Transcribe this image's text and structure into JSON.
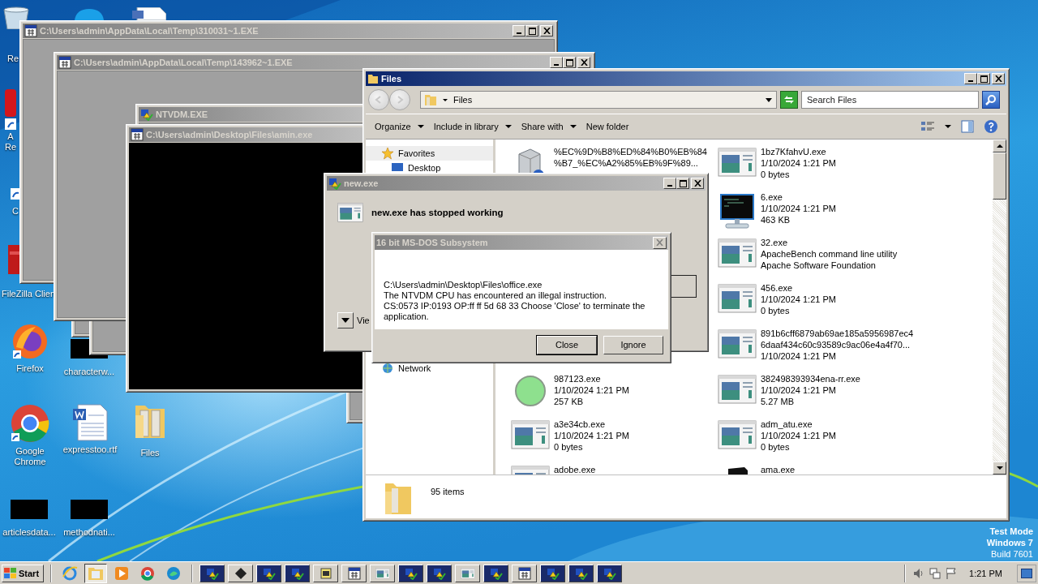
{
  "desktop_icons": [
    {
      "label": "Re",
      "kind": "recycle-bin"
    },
    {
      "label": "A Re",
      "kind": "acrobat"
    },
    {
      "label": "C",
      "kind": "shortcut"
    },
    {
      "label": "FileZilla Clien",
      "kind": "filezilla"
    },
    {
      "label": "Firefox",
      "kind": "firefox"
    },
    {
      "label": "characterw...",
      "kind": "black-thumbnail"
    },
    {
      "label": "Google Chrome",
      "kind": "chrome"
    },
    {
      "label": "expresstoo.rtf",
      "kind": "word"
    },
    {
      "label": "Files",
      "kind": "folder"
    },
    {
      "label": "articlesdata...",
      "kind": "black-thumbnail"
    },
    {
      "label": "methodnati...",
      "kind": "black-thumbnail"
    }
  ],
  "console_windows": [
    {
      "title": "C:\\Users\\admin\\AppData\\Local\\Temp\\310031~1.EXE"
    },
    {
      "title": "C:\\Users\\admin\\AppData\\Local\\Temp\\143962~1.EXE"
    }
  ],
  "ntvdm_window": {
    "title": "NTVDM.EXE"
  },
  "amin_window": {
    "title": "C:\\Users\\admin\\Desktop\\Files\\amin.exe"
  },
  "explorer": {
    "title": "Files",
    "path": "Files",
    "search": {
      "placeholder": "Search Files"
    },
    "toolbar": [
      {
        "label": "Organize",
        "menu": true
      },
      {
        "label": "Include in library",
        "menu": true
      },
      {
        "label": "Share with",
        "menu": true
      },
      {
        "label": "New folder",
        "menu": false
      }
    ],
    "nav_pane": [
      {
        "label": "Favorites",
        "kind": "favorites",
        "selected": true
      },
      {
        "label": "Desktop",
        "kind": "desktop",
        "selected": false
      },
      {
        "label": "Network",
        "kind": "network",
        "selected": false
      }
    ],
    "items_column_1": [
      {
        "kind": "service",
        "lines": [
          "%EC%9D%B8%ED%84%B0%EB%84",
          "%B7_%EC%A2%85%EB%9F%89..."
        ]
      },
      {
        "kind": "green-circle",
        "lines": [
          "987123.exe",
          "1/10/2024 1:21 PM",
          "257 KB"
        ]
      },
      {
        "kind": "exe",
        "lines": [
          "a3e34cb.exe",
          "1/10/2024 1:21 PM",
          "0 bytes"
        ]
      },
      {
        "kind": "exe",
        "lines": [
          "adobe.exe"
        ]
      }
    ],
    "items_column_2": [
      {
        "kind": "exe",
        "lines": [
          "1bz7KfahvU.exe",
          "1/10/2024 1:21 PM",
          "0 bytes"
        ]
      },
      {
        "kind": "console",
        "lines": [
          "6.exe",
          "1/10/2024 1:21 PM",
          "463 KB"
        ]
      },
      {
        "kind": "exe",
        "lines": [
          "32.exe",
          "ApacheBench command line utility",
          "Apache Software Foundation"
        ]
      },
      {
        "kind": "exe",
        "lines": [
          "456.exe",
          "1/10/2024 1:21 PM",
          "0 bytes"
        ]
      },
      {
        "kind": "exe",
        "lines": [
          "891b6cff6879ab69ae185a5956987ec4",
          "6daaf434c60c93589c9ac06e4a4f70...",
          "1/10/2024 1:21 PM"
        ]
      },
      {
        "kind": "exe",
        "lines": [
          "382498393934ena-rr.exe",
          "1/10/2024 1:21 PM",
          "5.27 MB"
        ]
      },
      {
        "kind": "exe",
        "lines": [
          "adm_atu.exe",
          "1/10/2024 1:21 PM",
          "0 bytes"
        ]
      },
      {
        "kind": "dark-box",
        "lines": [
          "ama.exe"
        ]
      }
    ],
    "status": "95 items"
  },
  "error_dialog": {
    "title": "new.exe",
    "heading": "new.exe has stopped working",
    "details_link": "Vie"
  },
  "msdos_dialog": {
    "title": "16 bit MS-DOS Subsystem",
    "message_lines": [
      "C:\\Users\\admin\\Desktop\\Files\\office.exe",
      "The NTVDM CPU has encountered an illegal instruction.",
      "CS:0573 IP:0193 OP:ff ff 5d 68 33 Choose 'Close' to terminate the application."
    ],
    "buttons": [
      {
        "label": "Close",
        "selected": true
      },
      {
        "label": "Ignore",
        "selected": false
      }
    ]
  },
  "desktop_note": [
    "Test Mode",
    "Windows 7",
    "Build 7601"
  ],
  "taskbar": {
    "start": "Start",
    "pinned": [
      {
        "kind": "ie",
        "selected": false
      },
      {
        "kind": "explorer",
        "selected": true
      },
      {
        "kind": "media",
        "selected": false
      },
      {
        "kind": "chrome",
        "selected": false
      },
      {
        "kind": "edge",
        "selected": false
      }
    ],
    "tasks": [
      {
        "kind": "ntvdm"
      },
      {
        "kind": "chip"
      },
      {
        "kind": "ntvdm"
      },
      {
        "kind": "ntvdm"
      },
      {
        "kind": "pif"
      },
      {
        "kind": "msdos"
      },
      {
        "kind": "exe"
      },
      {
        "kind": "ntvdm"
      },
      {
        "kind": "ntvdm"
      },
      {
        "kind": "exe"
      },
      {
        "kind": "ntvdm"
      },
      {
        "kind": "msdos"
      },
      {
        "kind": "ntvdm"
      },
      {
        "kind": "ntvdm"
      },
      {
        "kind": "ntvdm"
      }
    ],
    "clock": "1:21 PM"
  }
}
